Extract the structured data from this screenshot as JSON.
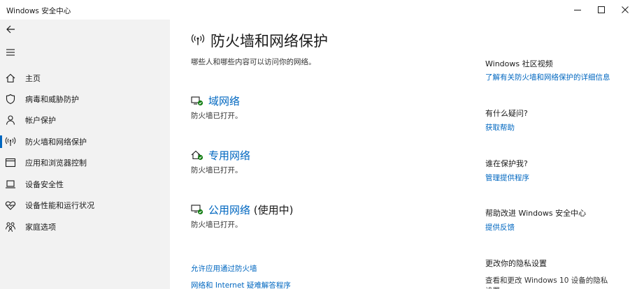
{
  "window": {
    "title": "Windows 安全中心"
  },
  "sidebar": {
    "items": [
      {
        "label": "主页",
        "icon": "home-icon"
      },
      {
        "label": "病毒和威胁防护",
        "icon": "shield-icon"
      },
      {
        "label": "帐户保护",
        "icon": "person-icon"
      },
      {
        "label": "防火墙和网络保护",
        "icon": "antenna-icon",
        "active": true
      },
      {
        "label": "应用和浏览器控制",
        "icon": "app-window-icon"
      },
      {
        "label": "设备安全性",
        "icon": "laptop-icon"
      },
      {
        "label": "设备性能和运行状况",
        "icon": "heart-pulse-icon"
      },
      {
        "label": "家庭选项",
        "icon": "family-icon"
      }
    ]
  },
  "main": {
    "title": "防火墙和网络保护",
    "subtitle": "哪些人和哪些内容可以访问你的网络。",
    "networks": [
      {
        "name": "域网络",
        "suffix": "",
        "status": "防火墙已打开。"
      },
      {
        "name": "专用网络",
        "suffix": "",
        "status": "防火墙已打开。"
      },
      {
        "name": "公用网络",
        "suffix": " (使用中)",
        "status": "防火墙已打开。"
      }
    ],
    "links": {
      "allow_app": "允许应用通过防火墙",
      "troubleshooter": "网络和 Internet 疑难解答程序"
    }
  },
  "right": {
    "video_heading": "Windows 社区视频",
    "video_link": "了解有关防火墙和网络保护的详细信息",
    "question_heading": "有什么疑问?",
    "help_link": "获取帮助",
    "protect_heading": "谁在保护我?",
    "providers_link": "管理提供程序",
    "improve_heading": "帮助改进 Windows 安全中心",
    "feedback_link": "提供反馈",
    "privacy_heading": "更改你的隐私设置",
    "privacy_text": "查看和更改 Windows 10 设备的隐私",
    "privacy_text2": "设置"
  },
  "colors": {
    "accent": "#0067c0",
    "sidebar_bg": "#f2f2f2",
    "network_ok": "#107c10"
  }
}
